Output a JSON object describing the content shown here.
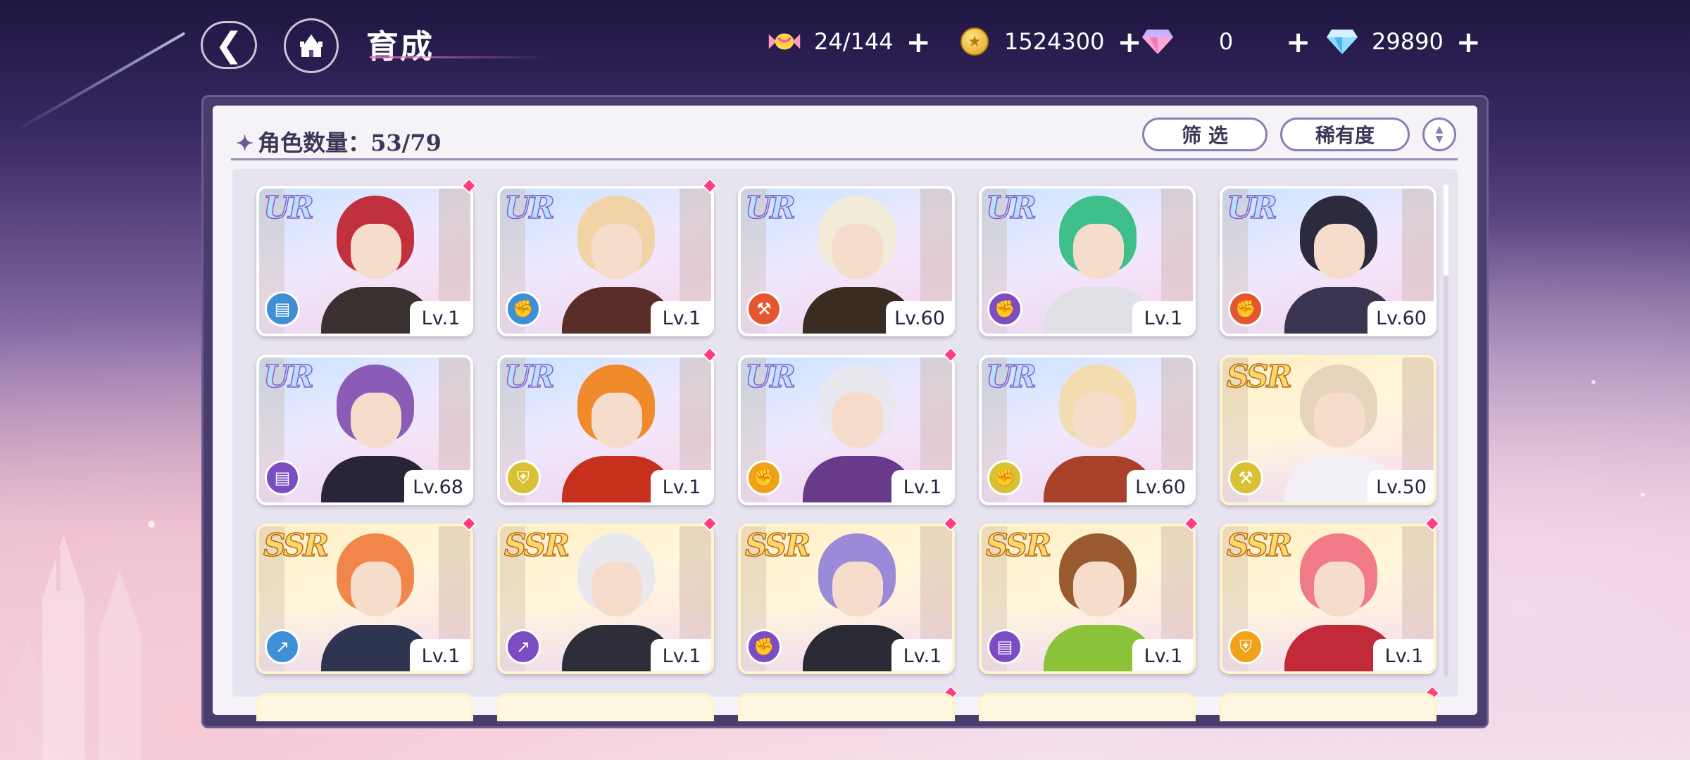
{
  "header": {
    "title": "育成",
    "back_icon": "back-arrow-icon",
    "home_icon": "castle-home-icon"
  },
  "currencies": [
    {
      "name": "candy",
      "icon": "candy-icon",
      "value": "24/144"
    },
    {
      "name": "gold-coin",
      "icon": "gold-coin-icon",
      "value": "1524300"
    },
    {
      "name": "pink-diamond",
      "icon": "pink-diamond-icon",
      "value": "0"
    },
    {
      "name": "blue-diamond",
      "icon": "blue-diamond-icon",
      "value": "29890"
    }
  ],
  "plus_label": "+",
  "toolbar": {
    "count_label": "角色数量：53/79",
    "filter_label": "筛 选",
    "rarity_label": "稀有度",
    "sort_icon": "sort-toggle-icon"
  },
  "colors": {
    "ur_text": "#b7e0ff",
    "ssr_text": "#ffd86b",
    "new_marker": "#ff3d7f",
    "blue_class": "#3f8fd6",
    "purple_class": "#7c4cc2",
    "orange_class": "#e3562f",
    "yellow_class": "#d8c233",
    "amber_class": "#f0a21a"
  },
  "cards": [
    {
      "rarity": "UR",
      "level": "Lv.1",
      "class_icon": "book-icon",
      "class_color": "#3f8fd6",
      "new": true,
      "hair": "#c0303d",
      "outfit": "#3a3030"
    },
    {
      "rarity": "UR",
      "level": "Lv.1",
      "class_icon": "fist-icon",
      "class_color": "#3f8fd6",
      "new": true,
      "hair": "#f1d3a6",
      "outfit": "#5a2e28"
    },
    {
      "rarity": "UR",
      "level": "Lv.60",
      "class_icon": "staff-icon",
      "class_color": "#e3562f",
      "new": false,
      "hair": "#f2ecd8",
      "outfit": "#3a2c20"
    },
    {
      "rarity": "UR",
      "level": "Lv.1",
      "class_icon": "fist-icon",
      "class_color": "#7c4cc2",
      "new": false,
      "hair": "#3fbf8a",
      "outfit": "#e0e0e6"
    },
    {
      "rarity": "UR",
      "level": "Lv.60",
      "class_icon": "fist-icon",
      "class_color": "#e3562f",
      "new": false,
      "hair": "#2c2a3e",
      "outfit": "#3a3450"
    },
    {
      "rarity": "UR",
      "level": "Lv.68",
      "class_icon": "book-icon",
      "class_color": "#7c4cc2",
      "new": false,
      "hair": "#8a5cb8",
      "outfit": "#2a2438"
    },
    {
      "rarity": "UR",
      "level": "Lv.1",
      "class_icon": "shield-icon",
      "class_color": "#d8c233",
      "new": true,
      "hair": "#f08a2a",
      "outfit": "#c7301c"
    },
    {
      "rarity": "UR",
      "level": "Lv.1",
      "class_icon": "fist-icon",
      "class_color": "#f0a21a",
      "new": true,
      "hair": "#e8e8ee",
      "outfit": "#6a3a8a"
    },
    {
      "rarity": "UR",
      "level": "Lv.60",
      "class_icon": "fist-icon",
      "class_color": "#d8c233",
      "new": false,
      "hair": "#f2dcb0",
      "outfit": "#a8402a"
    },
    {
      "rarity": "SSR",
      "level": "Lv.50",
      "class_icon": "staff-icon",
      "class_color": "#d8c233",
      "new": false,
      "hair": "#e6d4bc",
      "outfit": "#f2f0f6"
    },
    {
      "rarity": "SSR",
      "level": "Lv.1",
      "class_icon": "boot-icon",
      "class_color": "#3f8fd6",
      "new": true,
      "hair": "#f0864a",
      "outfit": "#2e3550"
    },
    {
      "rarity": "SSR",
      "level": "Lv.1",
      "class_icon": "boot-icon",
      "class_color": "#7c4cc2",
      "new": true,
      "hair": "#e8e8ee",
      "outfit": "#2e2e3a"
    },
    {
      "rarity": "SSR",
      "level": "Lv.1",
      "class_icon": "fist-icon",
      "class_color": "#7c4cc2",
      "new": true,
      "hair": "#9a8ad8",
      "outfit": "#2a2a34"
    },
    {
      "rarity": "SSR",
      "level": "Lv.1",
      "class_icon": "book-icon",
      "class_color": "#7c4cc2",
      "new": true,
      "hair": "#9a5a30",
      "outfit": "#8ac23a"
    },
    {
      "rarity": "SSR",
      "level": "Lv.1",
      "class_icon": "shield-icon",
      "class_color": "#f0a21a",
      "new": true,
      "hair": "#f07a86",
      "outfit": "#c22a3a"
    }
  ]
}
